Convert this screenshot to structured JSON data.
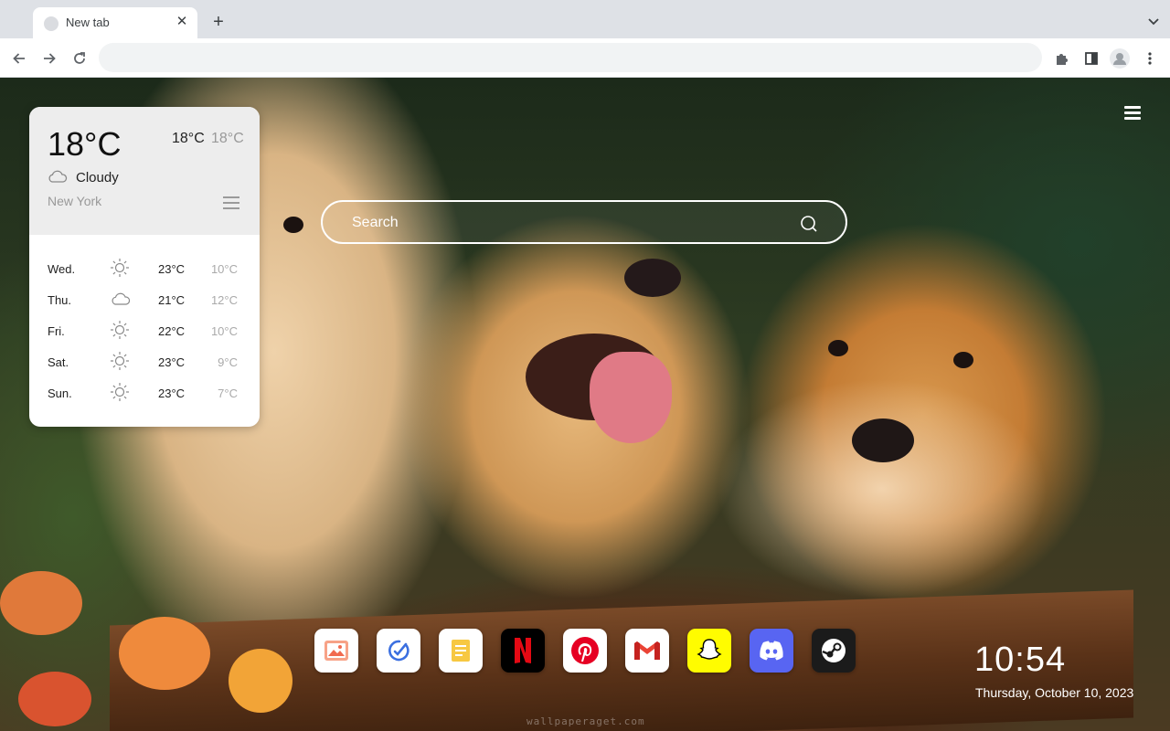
{
  "browser": {
    "tab": {
      "title": "New tab"
    },
    "omnibox": {
      "value": ""
    }
  },
  "weather": {
    "current_temp": "18°C",
    "today_high": "18°C",
    "today_low": "18°C",
    "condition": "Cloudy",
    "condition_icon": "cloud-icon",
    "city": "New York",
    "forecast": [
      {
        "day": "Wed.",
        "icon": "sun-icon",
        "high": "23°C",
        "low": "10°C"
      },
      {
        "day": "Thu.",
        "icon": "cloud-icon",
        "high": "21°C",
        "low": "12°C"
      },
      {
        "day": "Fri.",
        "icon": "sun-icon",
        "high": "22°C",
        "low": "10°C"
      },
      {
        "day": "Sat.",
        "icon": "sun-icon",
        "high": "23°C",
        "low": "9°C"
      },
      {
        "day": "Sun.",
        "icon": "sun-icon",
        "high": "23°C",
        "low": "7°C"
      }
    ]
  },
  "search": {
    "placeholder": "Search"
  },
  "dock": [
    {
      "name": "gallery",
      "icon": "image-icon"
    },
    {
      "name": "tasks",
      "icon": "check-icon"
    },
    {
      "name": "notes",
      "icon": "note-icon"
    },
    {
      "name": "netflix",
      "icon": "netflix-icon"
    },
    {
      "name": "pinterest",
      "icon": "pinterest-icon"
    },
    {
      "name": "gmail",
      "icon": "gmail-icon"
    },
    {
      "name": "snapchat",
      "icon": "snapchat-icon"
    },
    {
      "name": "discord",
      "icon": "discord-icon"
    },
    {
      "name": "steam",
      "icon": "steam-icon"
    }
  ],
  "clock": {
    "time": "10:54",
    "date": "Thursday, October 10, 2023"
  },
  "watermark": "wallpaperaget.com"
}
